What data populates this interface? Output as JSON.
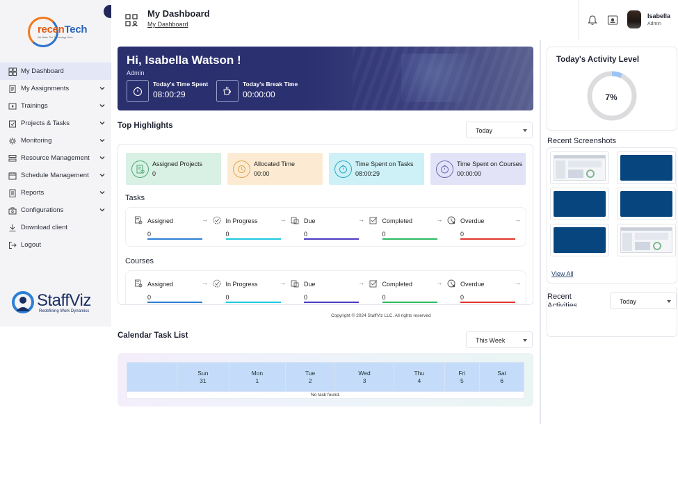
{
  "sidebar": {
    "logo": {
      "text_a": "recen",
      "text_b": "Tech",
      "tagline": "We Make The Technology Work"
    },
    "items": [
      {
        "label": "My Dashboard",
        "icon": "dashboard-icon",
        "active": true,
        "has_chevron": false
      },
      {
        "label": "My Assignments",
        "icon": "assignments-icon",
        "active": false,
        "has_chevron": true
      },
      {
        "label": "Trainings",
        "icon": "training-icon",
        "active": false,
        "has_chevron": true
      },
      {
        "label": "Projects & Tasks",
        "icon": "projects-icon",
        "active": false,
        "has_chevron": true
      },
      {
        "label": "Monitoring",
        "icon": "monitoring-icon",
        "active": false,
        "has_chevron": true
      },
      {
        "label": "Resource Management",
        "icon": "resource-icon",
        "active": false,
        "has_chevron": true
      },
      {
        "label": "Schedule Management",
        "icon": "schedule-icon",
        "active": false,
        "has_chevron": true
      },
      {
        "label": "Reports",
        "icon": "reports-icon",
        "active": false,
        "has_chevron": true
      },
      {
        "label": "Configurations",
        "icon": "config-icon",
        "active": false,
        "has_chevron": true
      },
      {
        "label": "Download client",
        "icon": "download-icon",
        "active": false,
        "has_chevron": false
      },
      {
        "label": "Logout",
        "icon": "logout-icon",
        "active": false,
        "has_chevron": false
      }
    ],
    "brand": {
      "name": "StaffViz",
      "tagline": "Redefining Work Dynamics"
    }
  },
  "header": {
    "title": "My Dashboard",
    "breadcrumb": "My Dashboard",
    "user": {
      "name": "Isabella",
      "role": "Admin"
    }
  },
  "banner": {
    "greeting": "Hi, Isabella Watson !",
    "role": "Admin",
    "time_spent_label": "Today's Time Spent",
    "time_spent_value": "08:00:29",
    "break_label": "Today's Break Time",
    "break_value": "00:00:00"
  },
  "highlights": {
    "title": "Top Highlights",
    "filter": "Today",
    "cards": [
      {
        "label": "Assigned Projects",
        "value": "0",
        "bg": "#d8f1e4",
        "accent": "#4fa878"
      },
      {
        "label": "Allocated Time",
        "value": "00:00",
        "bg": "#fcebd2",
        "accent": "#e2a44c"
      },
      {
        "label": "Time Spent on Tasks",
        "value": "08:00:29",
        "bg": "#cdf1f7",
        "accent": "#2fa7c0"
      },
      {
        "label": "Time Spent on Courses",
        "value": "00:00:00",
        "bg": "#e3e3f8",
        "accent": "#6b6bb8"
      }
    ]
  },
  "tasks": {
    "title": "Tasks",
    "stats": [
      {
        "label": "Assigned",
        "value": "0",
        "color": "#2d7fd6"
      },
      {
        "label": "In Progress",
        "value": "0",
        "color": "#1ec8e0"
      },
      {
        "label": "Due",
        "value": "0",
        "color": "#4b3bc2"
      },
      {
        "label": "Completed",
        "value": "0",
        "color": "#2aba62"
      },
      {
        "label": "Overdue",
        "value": "0",
        "color": "#e2352a"
      }
    ]
  },
  "courses": {
    "title": "Courses",
    "stats": [
      {
        "label": "Assigned",
        "value": "0",
        "color": "#2d7fd6"
      },
      {
        "label": "In Progress",
        "value": "0",
        "color": "#1ec8e0"
      },
      {
        "label": "Due",
        "value": "0",
        "color": "#4b3bc2"
      },
      {
        "label": "Completed",
        "value": "0",
        "color": "#2aba62"
      },
      {
        "label": "Overdue",
        "value": "0",
        "color": "#e2352a"
      }
    ]
  },
  "footer": {
    "copyright": "Copyright © 2024 StaffViz LLC. All rights reserved"
  },
  "calendar": {
    "title": "Calendar Task List",
    "filter": "This Week",
    "days": [
      {
        "day": "Sun",
        "date": "31"
      },
      {
        "day": "Mon",
        "date": "1"
      },
      {
        "day": "Tue",
        "date": "2"
      },
      {
        "day": "Wed",
        "date": "3"
      },
      {
        "day": "Thu",
        "date": "4"
      },
      {
        "day": "Fri",
        "date": "5"
      },
      {
        "day": "Sat",
        "date": "6"
      }
    ],
    "empty_text": "No task found."
  },
  "activity": {
    "title": "Today's Activity Level",
    "percent": 7,
    "label": "7%"
  },
  "screenshots": {
    "title": "Recent Screenshots",
    "items": [
      {
        "kind": "screen"
      },
      {
        "kind": "blue"
      },
      {
        "kind": "blue"
      },
      {
        "kind": "blue"
      },
      {
        "kind": "blue"
      },
      {
        "kind": "screen"
      }
    ],
    "view_all": "View All"
  },
  "recent_activities": {
    "title": "Recent Activities",
    "filter": "Today"
  },
  "colors": {
    "sidebar_bg": "#f4f4f6",
    "active_item": "#e4e7f5",
    "banner": "#2a2f6e",
    "brand": "#1a2f63"
  }
}
